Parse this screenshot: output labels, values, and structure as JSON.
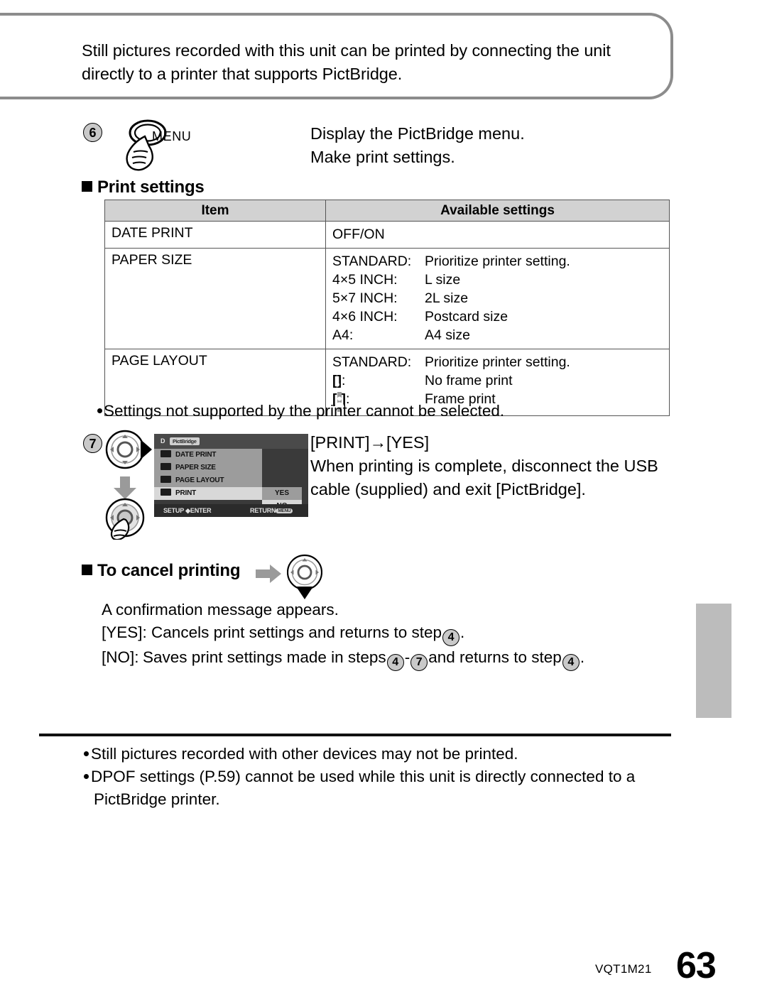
{
  "intro": {
    "text": "Still pictures recorded with this unit can be printed by connecting the unit directly to a printer that supports PictBridge."
  },
  "step6": {
    "number": "6",
    "button_label": "MENU",
    "icon": "menu-button-press-icon",
    "description": "Display the PictBridge menu.\nMake print settings."
  },
  "print_settings_section": {
    "heading": "Print settings",
    "table": {
      "headers": [
        "Item",
        "Available settings"
      ],
      "rows": [
        {
          "item": "DATE PRINT",
          "settings": [
            {
              "label": "OFF/ON",
              "value": ""
            }
          ]
        },
        {
          "item": "PAPER SIZE",
          "settings": [
            {
              "label": "STANDARD:",
              "value": "Prioritize printer setting."
            },
            {
              "label": "4×5 INCH:",
              "value": "L size"
            },
            {
              "label": "5×7 INCH:",
              "value": "2L size"
            },
            {
              "label": "4×6 INCH:",
              "value": "Postcard size"
            },
            {
              "label": "A4:",
              "value": "A4 size"
            }
          ]
        },
        {
          "item": "PAGE LAYOUT",
          "settings": [
            {
              "label": "STANDARD:",
              "value": "Prioritize printer setting."
            },
            {
              "label": "[no-frame-icon]:",
              "value": "No frame print",
              "icon": "no-frame-print-icon"
            },
            {
              "label": "[frame-icon]:",
              "value": "Frame print",
              "icon": "frame-print-icon"
            }
          ]
        }
      ]
    },
    "note": "Settings not supported by the printer cannot be selected."
  },
  "step7": {
    "number": "7",
    "icons": [
      "dpad-right-icon",
      "down-arrow-icon",
      "dpad-press-icon"
    ],
    "description_line1": "[PRINT]→[YES]",
    "description_line2": "When printing is complete, disconnect the USB cable (supplied) and exit [PictBridge].",
    "lcd": {
      "title_page_icon": "page-icon",
      "title_chip": "PictBridge",
      "menu_items": [
        {
          "label": "DATE PRINT",
          "icon": "date-print-icon",
          "selected": false
        },
        {
          "label": "PAPER SIZE",
          "icon": "paper-size-icon",
          "selected": false
        },
        {
          "label": "PAGE LAYOUT",
          "icon": "page-layout-icon",
          "selected": false
        },
        {
          "label": "PRINT",
          "icon": "printer-icon",
          "selected": true
        }
      ],
      "choices": [
        {
          "label": "YES",
          "highlighted": true
        },
        {
          "label": "NO",
          "highlighted": false
        }
      ],
      "footer_left": "SETUP",
      "footer_left_2": "ENTER",
      "footer_right": "RETURN",
      "footer_right_chip": "MENU"
    }
  },
  "cancel_section": {
    "heading": "To cancel printing",
    "arrow_icon": "right-arrow-icon",
    "dpad_icon": "dpad-down-icon",
    "line1": "A confirmation message appears.",
    "line2_label": "[YES]:",
    "line2_a": "Cancels print settings and returns to step",
    "line2_badge": "4",
    "line2_end": ".",
    "line3_label": "[NO]:",
    "line3_a": "Saves print settings made in steps",
    "line3_badge1": "4",
    "line3_dash": "-",
    "line3_badge2": "7",
    "line3_b": "and returns to step",
    "line3_badge3": "4",
    "line3_end": "."
  },
  "notes": [
    "Still pictures recorded with other devices may not be printed.",
    "DPOF settings (P.59) cannot be used while this unit is directly connected to a PictBridge printer."
  ],
  "footer": {
    "code": "VQT1M21",
    "page": "63"
  },
  "colors": {
    "table_header_bg": "#d2d2d2",
    "badge_bg": "#c9c9c9",
    "box_border": "#8c8c8c",
    "side_tab": "#bcbcbc"
  }
}
